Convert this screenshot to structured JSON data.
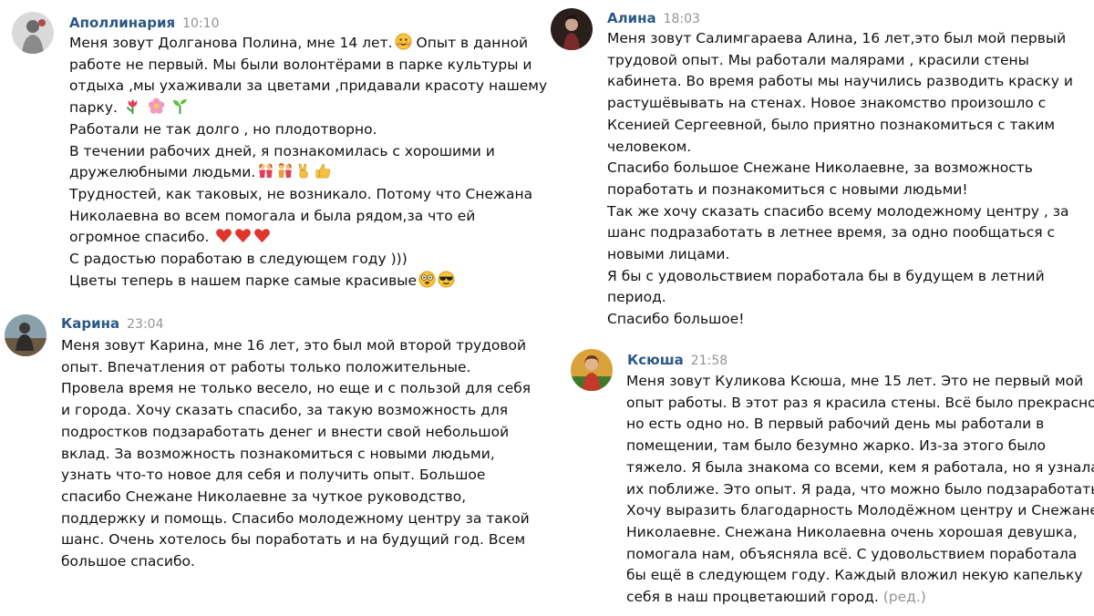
{
  "messages": [
    {
      "author": "Аполлинария",
      "time": "10:10",
      "lines": [
        "Меня зовут Долганова Полина, мне 14 лет.",
        "работе не первый. Мы были волонтёрами в парке культуры и",
        "отдыха ,мы ухаживали за цветами ,придавали красоту нашему",
        "парку.",
        "Работали не так долго , но плодотворно.",
        "В течении рабочих дней, я познакомилась с хорошими и",
        "дружелюбными людьми.",
        "Трудностей, как таковых, не возникало. Потому что Снежана",
        "Николаевна во всем помогала и была рядом,за что ей",
        "огромное спасибо.",
        "С радостью поработаю в следующем году )))",
        "Цветы теперь в нашем парке самые красивые"
      ],
      "line0_tail": "Опыт в данной"
    },
    {
      "author": "Карина",
      "time": "23:04",
      "lines": [
        "Меня зовут Карина, мне 16 лет, это был мой второй трудовой",
        "опыт. Впечатления от работы только положительные.",
        "Провела время не только весело, но еще и с пользой для себя",
        "и города. Хочу сказать спасибо, за такую возможность для",
        "подростков подзаработать денег и внести свой небольшой",
        "вклад. За возможность познакомиться с новыми людьми,",
        "узнать что-то новое для себя и получить опыт. Большое",
        "спасибо Снежане Николаевне за чуткое руководство,",
        "поддержку и помощь. Спасибо молодежному центру за такой",
        "шанс. Очень хотелось бы поработать и на будущий год. Всем",
        "большое спасибо."
      ]
    },
    {
      "author": "Алина",
      "time": "18:03",
      "lines": [
        "Меня зовут Салимгараева Алина, 16 лет,это был мой первый",
        "трудовой опыт. Мы работали малярами , красили стены",
        "кабинета. Во время работы мы научились разводить краску и",
        "растушёвывать на стенах. Новое знакомство произошло с",
        "Ксенией Сергеевной, было приятно познакомиться с таким",
        "человеком.",
        "Спасибо большое Снежане Николаевне, за возможность",
        "поработать и познакомиться с новыми людьми!",
        "Так же хочу сказать спасибо всему молодежному центру , за",
        "шанс подразаботать в летнее время, за одно пообщаться с",
        "новыми лицами.",
        "Я бы с удовольствием поработала бы в будущем в летний",
        "период.",
        "Спасибо большое!"
      ]
    },
    {
      "author": "Ксюша",
      "time": "21:58",
      "lines": [
        "Меня зовут Куликова Ксюша, мне 15 лет. Это не первый мой",
        "опыт работы. В этот раз я красила стены. Всё было прекрасно,",
        "но есть одно но. В первый рабочий день мы работали в",
        "помещении, там было безумно жарко. Из-за этого было",
        "тяжело. Я была знакома со всеми, кем я работала, но я узнала",
        "их поближе. Это опыт. Я рада, что можно было подзаработать.",
        "Хочу выразить благодарность Молодёжном центру и Снежане",
        "Николаевне. Снежана Николаевна очень хорошая девушка,",
        "помогала нам, объясняла всё. С удовольствием поработала",
        "бы ещё в следующем году. Каждый вложил некую капельку",
        "себя в наш процветаюший город."
      ],
      "edited_label": "(ред.)"
    }
  ]
}
